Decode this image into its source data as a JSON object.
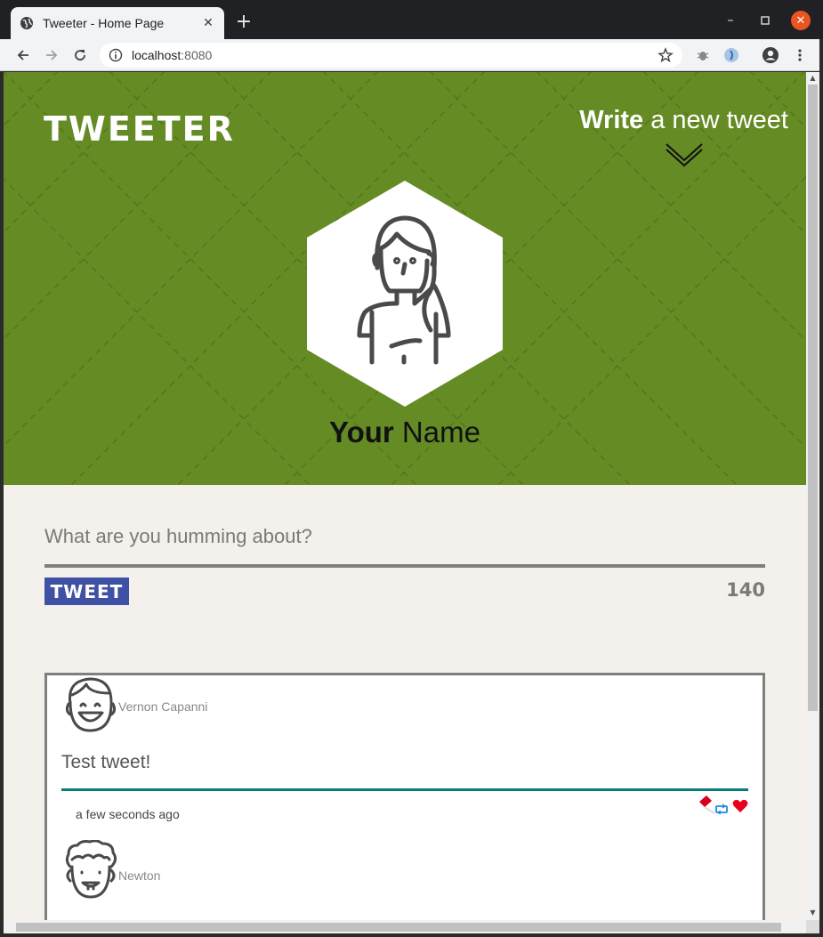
{
  "browser": {
    "tab_title": "Tweeter - Home Page",
    "new_tab": "+",
    "url_host": "localhost",
    "url_port": ":8080"
  },
  "header": {
    "brand": "TWEETER",
    "compose_bold": "Write",
    "compose_rest": " a new tweet",
    "user_first": "Your",
    "user_last": " Name"
  },
  "composer": {
    "placeholder": "What are you humming about?",
    "button_label": "TWEET",
    "counter": "140"
  },
  "tweets": [
    {
      "author": "Vernon Capanni",
      "text": "Test tweet!",
      "time": "a few seconds ago",
      "avatar_icon": "smiling-boy-icon"
    },
    {
      "author": "Newton",
      "avatar_icon": "curly-hair-boy-icon"
    }
  ],
  "icons": {
    "actions": [
      "flag-icon",
      "retweet-icon",
      "heart-icon"
    ]
  },
  "colors": {
    "hero_green": "#658b24",
    "page_bg": "#f4f1ec",
    "tweet_button": "#3f51a5",
    "tweet_rule": "#0b7a7a",
    "heart": "#e8001c",
    "flag": "#d6001c",
    "retweet": "#1e88e5"
  }
}
